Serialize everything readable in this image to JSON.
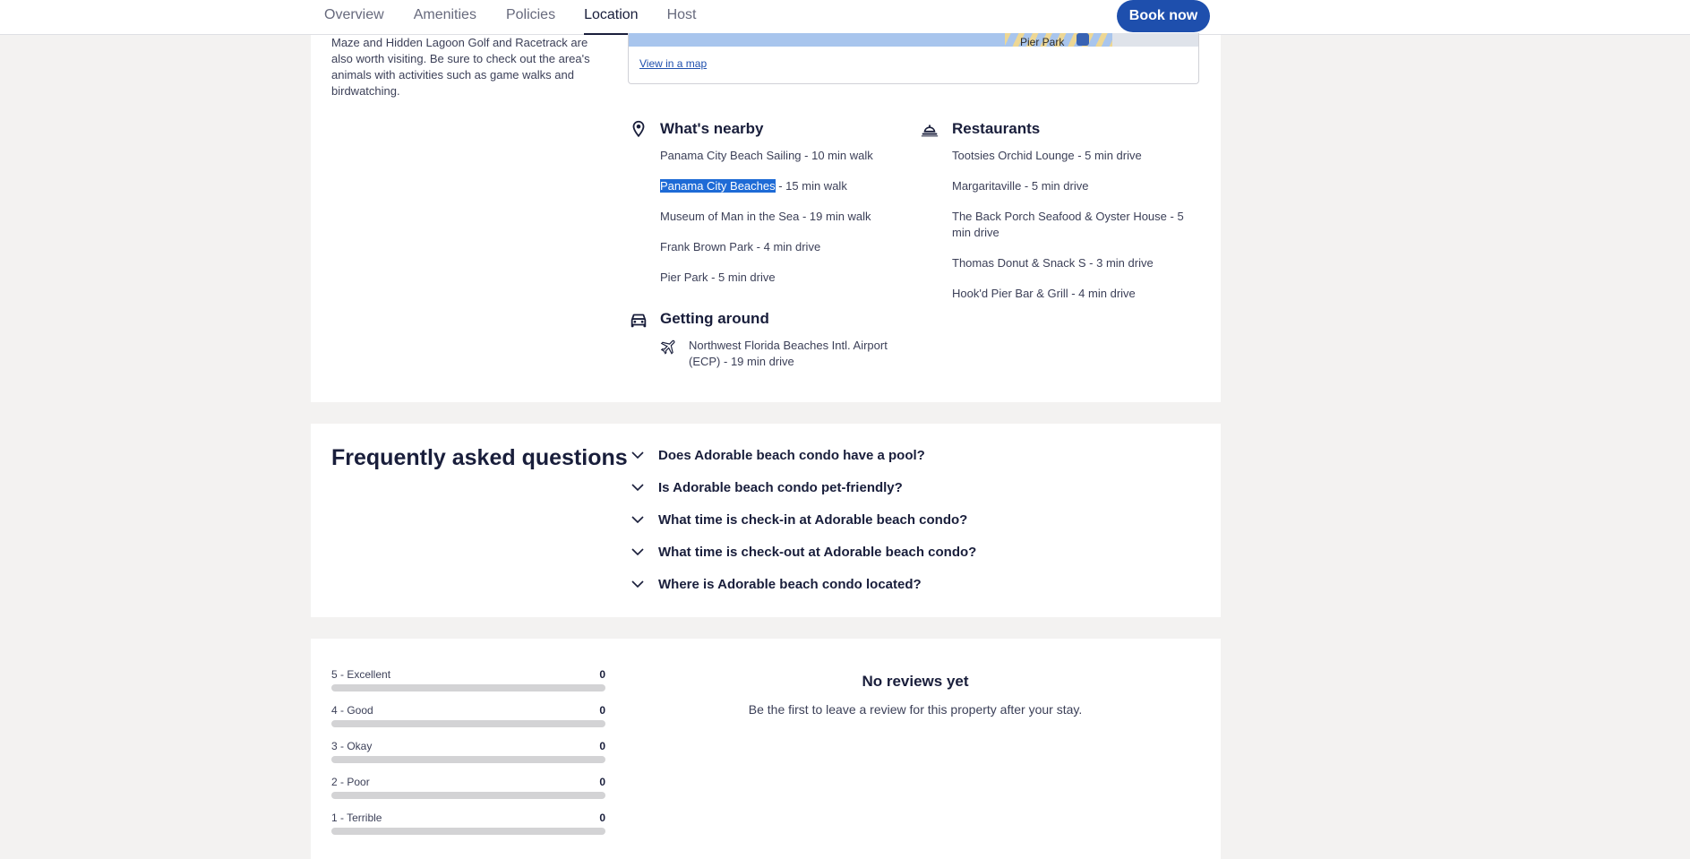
{
  "nav": {
    "tabs": [
      {
        "label": "Overview"
      },
      {
        "label": "Amenities"
      },
      {
        "label": "Policies"
      },
      {
        "label": "Location",
        "active": true
      },
      {
        "label": "Host"
      }
    ],
    "book_now": "Book now"
  },
  "location": {
    "description": "Maze and Hidden Lagoon Golf and Racetrack are also worth visiting. Be sure to check out the area's animals with activities such as game walks and birdwatching.",
    "map_label": "Pier Park",
    "view_map": "View in a map",
    "nearby": {
      "title": "What's nearby",
      "icon": "map-pin-icon",
      "items": [
        {
          "name": "Panama City Beach Sailing",
          "suffix": " - 10 min walk"
        },
        {
          "name": "Panama City Beaches",
          "suffix": " - 15 min walk",
          "selected": true
        },
        {
          "name": "Museum of Man in the Sea",
          "suffix": " - 19 min walk"
        },
        {
          "name": "Frank Brown Park",
          "suffix": " - 4 min drive"
        },
        {
          "name": "Pier Park",
          "suffix": " - 5 min drive"
        }
      ]
    },
    "restaurants": {
      "title": "Restaurants",
      "icon": "dining-icon",
      "items": [
        {
          "line1": "Tootsies Orchid Lounge - 5 min drive",
          "line2": ""
        },
        {
          "line1": "Margaritaville - 5 min drive",
          "line2": ""
        },
        {
          "line1": "The Back Porch Seafood & Oyster House - 5",
          "line2": "min drive"
        },
        {
          "line1": "Thomas Donut & Snack S - 3 min drive",
          "line2": ""
        },
        {
          "line1": "Hook'd Pier Bar & Grill - 4 min drive",
          "line2": ""
        }
      ]
    },
    "getting_around": {
      "title": "Getting around",
      "icon": "car-icon",
      "airport_icon": "airplane-icon",
      "airport_line1": "Northwest Florida Beaches Intl. Airport",
      "airport_line2": "(ECP) - 19 min drive"
    }
  },
  "faq": {
    "title": "Frequently asked questions",
    "questions": [
      "Does Adorable beach condo have a pool?",
      "Is Adorable beach condo pet-friendly?",
      "What time is check-in at Adorable beach condo?",
      "What time is check-out at Adorable beach condo?",
      "Where is Adorable beach condo located?"
    ]
  },
  "reviews": {
    "ratings": [
      {
        "label": "5 - Excellent",
        "count": "0",
        "fraction": 0
      },
      {
        "label": "4 - Good",
        "count": "0",
        "fraction": 0
      },
      {
        "label": "3 - Okay",
        "count": "0",
        "fraction": 0
      },
      {
        "label": "2 - Poor",
        "count": "0",
        "fraction": 0
      },
      {
        "label": "1 - Terrible",
        "count": "0",
        "fraction": 0
      }
    ],
    "empty_title": "No reviews yet",
    "empty_subtitle": "Be the first to leave a review for this property after your stay."
  },
  "colors": {
    "accent": "#1e4fad",
    "selection": "#1e6bd6",
    "background": "#f3f2f1"
  }
}
